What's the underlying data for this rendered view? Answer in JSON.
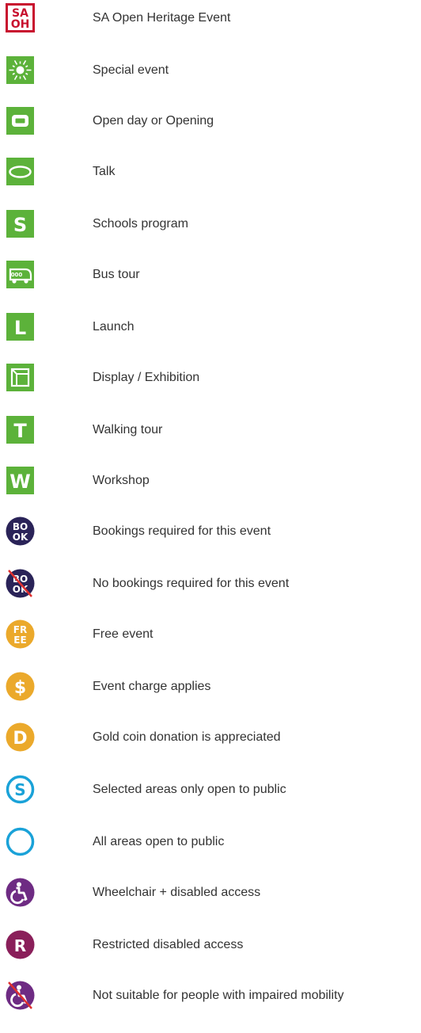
{
  "legend": [
    {
      "icon": "sa-open-heritage-logo-icon",
      "label": "SA Open Heritage Event",
      "logo_text": [
        "SA",
        "OH"
      ]
    },
    {
      "icon": "special-event-sparkle-icon",
      "label": "Special event"
    },
    {
      "icon": "open-day-icon",
      "label": "Open day or Opening",
      "glyph": ""
    },
    {
      "icon": "talk-icon",
      "label": "Talk"
    },
    {
      "icon": "schools-program-icon",
      "label": "Schools program",
      "glyph": "S"
    },
    {
      "icon": "bus-tour-icon",
      "label": "Bus tour"
    },
    {
      "icon": "launch-icon",
      "label": "Launch",
      "glyph": "L"
    },
    {
      "icon": "display-exhibition-icon",
      "label": "Display / Exhibition"
    },
    {
      "icon": "walking-tour-icon",
      "label": "Walking tour",
      "glyph": "T"
    },
    {
      "icon": "workshop-icon",
      "label": "Workshop",
      "glyph": "W"
    },
    {
      "icon": "bookings-required-icon",
      "label": "Bookings required for this event",
      "glyph": [
        "BO",
        "OK"
      ]
    },
    {
      "icon": "no-bookings-required-icon",
      "label": "No bookings required for this event",
      "glyph": [
        "BO",
        "OK"
      ]
    },
    {
      "icon": "free-event-icon",
      "label": "Free event",
      "glyph": [
        "FR",
        "EE"
      ]
    },
    {
      "icon": "event-charge-icon",
      "label": "Event charge applies",
      "glyph": "$"
    },
    {
      "icon": "gold-coin-donation-icon",
      "label": "Gold coin donation is appreciated",
      "glyph": "D"
    },
    {
      "icon": "selected-areas-icon",
      "label": "Selected areas only open to public",
      "glyph": "S"
    },
    {
      "icon": "all-areas-icon",
      "label": "All areas open to public"
    },
    {
      "icon": "wheelchair-access-icon",
      "label": "Wheelchair + disabled access"
    },
    {
      "icon": "restricted-access-icon",
      "label": "Restricted disabled access",
      "glyph": "R"
    },
    {
      "icon": "not-suitable-mobility-icon",
      "label": "Not suitable for people with impaired mobility"
    }
  ],
  "colors": {
    "heritage_red": "#c8102e",
    "event_green": "#5cb23a",
    "booking_navy": "#2a2358",
    "cost_gold": "#eba92b",
    "area_blue": "#1aa2d8",
    "access_purple": "#6e2b83",
    "access_magenta": "#8a1f5a",
    "cross_red": "#e0302f",
    "label_text": "#333333"
  }
}
